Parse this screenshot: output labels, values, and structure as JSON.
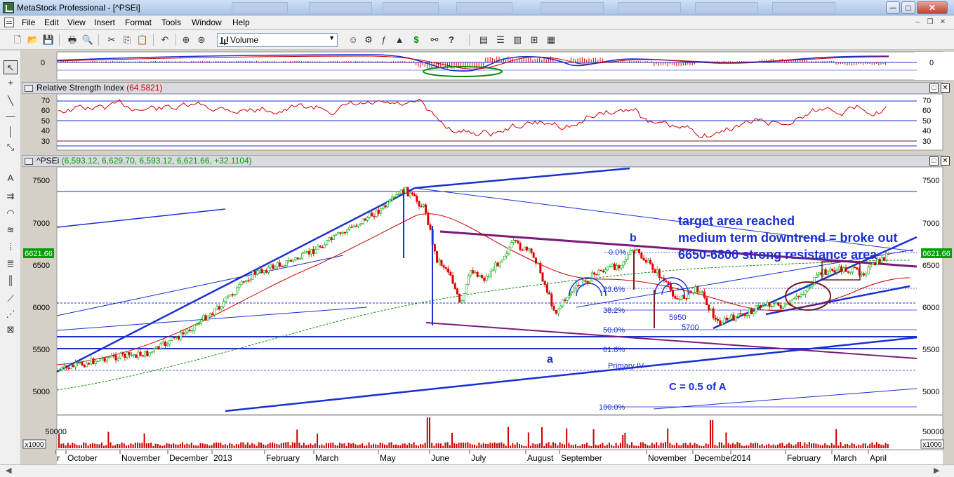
{
  "window": {
    "title": "MetaStock Professional - [^PSEi]",
    "minimize": "─",
    "maximize": "□",
    "close": "✕"
  },
  "menu": {
    "items": [
      "File",
      "Edit",
      "View",
      "Insert",
      "Format",
      "Tools",
      "Window",
      "Help"
    ]
  },
  "toolbar": {
    "indicator_select": "Volume"
  },
  "macd_pane": {
    "zero_label": "0"
  },
  "rsi_pane": {
    "title": "Relative Strength Index",
    "value": "(64.5821)",
    "value_color": "#cc0000",
    "levels": [
      "70",
      "60",
      "50",
      "40",
      "30"
    ]
  },
  "price_pane": {
    "title": "^PSEi",
    "ohlc": "(6,593.12, 6,629.70, 6,593.12, 6,621.66, +32.1104)",
    "ohlc_color": "#00a000",
    "last_price": "6621.66",
    "y_ticks": [
      "7500",
      "7000",
      "6500",
      "6000",
      "5500",
      "5000"
    ],
    "annotations": {
      "line1": "target area reached",
      "line2": "medium term downtrend = broke out",
      "line3": "6650-6800 strong resistance area",
      "c_note": "C = 0.5 of A",
      "wave_a": "a",
      "wave_b": "b",
      "primary": "Primary IV",
      "level_5950": "5950",
      "level_5700": "5700"
    },
    "fib_levels": [
      "0.0%",
      "23.6%",
      "38.2%",
      "50.0%",
      "61.8%",
      "100.0%"
    ],
    "annotation_color": "#1a2fd0"
  },
  "volume_pane": {
    "y_tick": "50000",
    "multiplier": "x1000"
  },
  "x_axis": {
    "labels": [
      "r",
      "October",
      "November",
      "December",
      "2013",
      "February",
      "March",
      "May",
      "June",
      "July",
      "August",
      "September",
      "November",
      "December",
      "2014",
      "February",
      "March",
      "April"
    ]
  },
  "colors": {
    "price_up": "#00b000",
    "price_down": "#e00000",
    "trendline": "#1a2fd0",
    "purple_line": "#7a1a7a",
    "rsi_line": "#cc0000",
    "macd_blue": "#1a2fd0",
    "macd_red": "#cc0000"
  }
}
